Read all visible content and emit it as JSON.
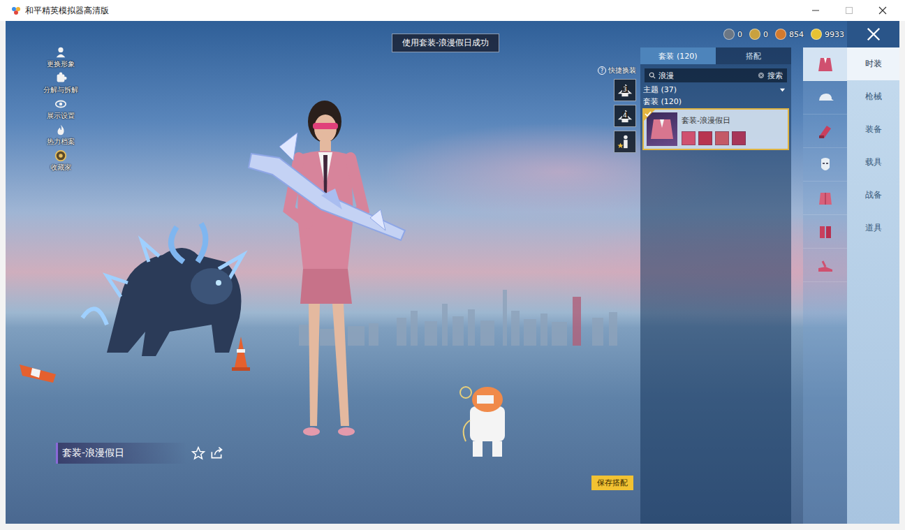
{
  "window": {
    "title": "和平精英模拟器高清版"
  },
  "toast": "使用套装-浪漫假日成功",
  "currencies": [
    {
      "amount": "0",
      "color": "#6b7785"
    },
    {
      "amount": "0",
      "color": "#c9a13f"
    },
    {
      "amount": "854",
      "color": "#d27a2e"
    },
    {
      "amount": "9933",
      "color": "#e8c232"
    }
  ],
  "left_menu": [
    {
      "label": "更换形象"
    },
    {
      "label": "分解与拆解"
    },
    {
      "label": "展示设置"
    },
    {
      "label": "热力档案"
    },
    {
      "label": "收藏家"
    }
  ],
  "quick_change": {
    "label": "快捷换装",
    "help": "?",
    "slots": [
      {
        "kind": "hanger",
        "number": "3"
      },
      {
        "kind": "hanger",
        "number": "4"
      },
      {
        "kind": "figure"
      }
    ]
  },
  "panel": {
    "tabs": [
      {
        "label": "套装 (120)",
        "selected": true
      },
      {
        "label": "搭配",
        "selected": false
      }
    ],
    "search": {
      "value": "浪漫",
      "button": "搜索"
    },
    "filters": [
      {
        "label": "主题 (37)",
        "expandable": true
      },
      {
        "label": "套装 (120)",
        "expandable": false
      }
    ],
    "items": [
      {
        "title": "套装-浪漫假日",
        "selected": true,
        "parts": [
          {
            "color": "#d0506f"
          },
          {
            "color": "#b8344f"
          },
          {
            "color": "#c45a66"
          },
          {
            "color": "#a83658"
          }
        ]
      }
    ]
  },
  "category_icons": [
    {
      "kind": "suit",
      "selected": true
    },
    {
      "kind": "hat",
      "selected": false
    },
    {
      "kind": "gloves",
      "selected": false
    },
    {
      "kind": "mask",
      "selected": false
    },
    {
      "kind": "jacket",
      "selected": false
    },
    {
      "kind": "pants",
      "selected": false
    },
    {
      "kind": "shoes",
      "selected": false
    }
  ],
  "nav": [
    {
      "label": "时装",
      "selected": true
    },
    {
      "label": "枪械",
      "selected": false
    },
    {
      "label": "装备",
      "selected": false
    },
    {
      "label": "载具",
      "selected": false
    },
    {
      "label": "战备",
      "selected": false
    },
    {
      "label": "道具",
      "selected": false
    }
  ],
  "showcase": {
    "name": "套装-浪漫假日"
  },
  "save_button": "保存搭配"
}
